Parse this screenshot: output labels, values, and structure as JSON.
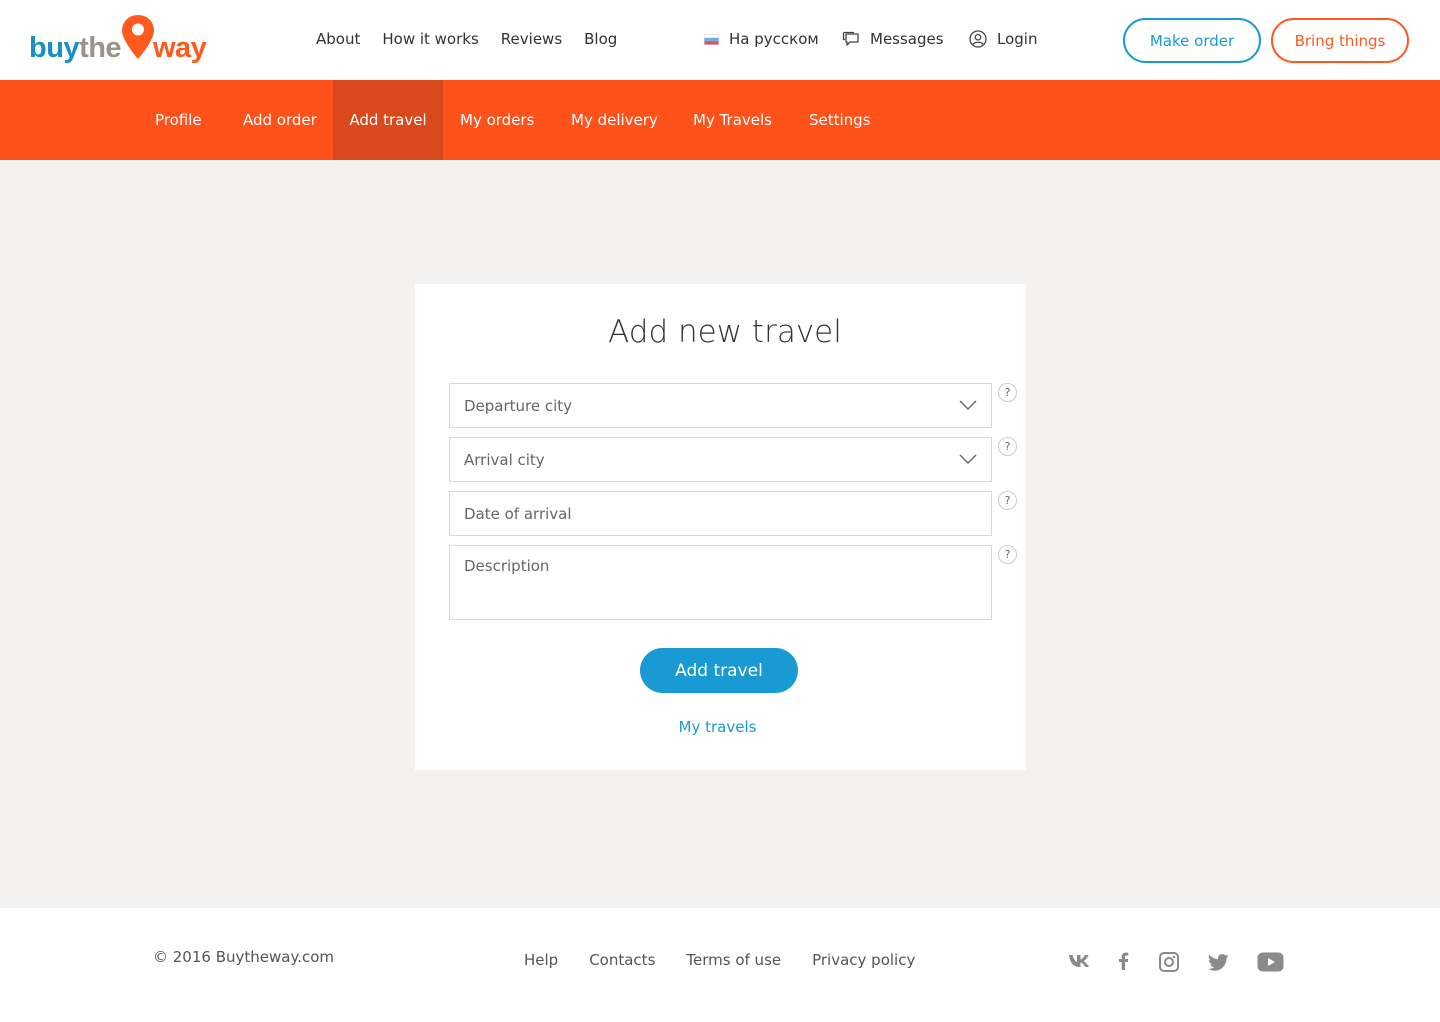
{
  "header": {
    "logo": {
      "buy": "buy",
      "the": "the",
      "way": "way"
    },
    "nav": [
      "About",
      "How it works",
      "Reviews",
      "Blog"
    ],
    "language": "На русском",
    "messages": "Messages",
    "login": "Login",
    "make_order": "Make order",
    "bring_things": "Bring things"
  },
  "subnav": {
    "items": [
      "Profile",
      "Add order",
      "Add travel",
      "My orders",
      "My delivery",
      "My Travels",
      "Settings"
    ],
    "active": "Add travel"
  },
  "form": {
    "title": "Add new travel",
    "departure_placeholder": "Departure city",
    "arrival_placeholder": "Arrival city",
    "date_placeholder": "Date of arrival",
    "description_placeholder": "Description",
    "help_glyph": "?",
    "submit_label": "Add travel",
    "my_travels_link": "My travels"
  },
  "footer": {
    "copyright": "© 2016 Buytheway.com",
    "links": [
      "Help",
      "Contacts",
      "Terms of use",
      "Privacy policy"
    ],
    "social": [
      "vk-icon",
      "facebook-icon",
      "instagram-icon",
      "twitter-icon",
      "youtube-icon"
    ]
  },
  "colors": {
    "accent_orange": "#ff521b",
    "accent_blue": "#1a9ad3",
    "active_tab": "#d9491d"
  }
}
